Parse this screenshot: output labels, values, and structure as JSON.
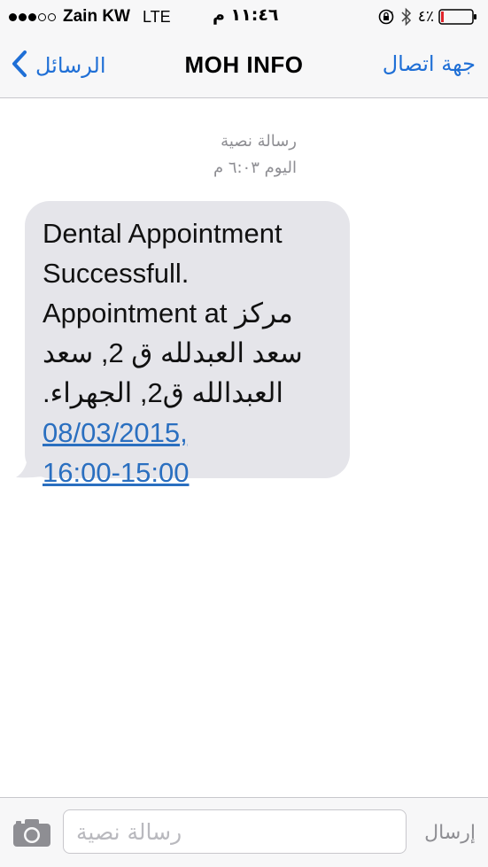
{
  "status_bar": {
    "signal_strength": 3,
    "signal_max": 5,
    "carrier": "Zain KW",
    "network": "LTE",
    "time": "١١:٤٦ م",
    "battery_percent": "٤٪",
    "icons": [
      "rotation-lock-icon",
      "bluetooth-icon",
      "battery-icon"
    ]
  },
  "nav": {
    "back_label": "الرسائل",
    "title": "MOH INFO",
    "contact_label": "جهة اتصال"
  },
  "message": {
    "type_label": "رسالة نصية",
    "timestamp": "اليوم ٦:٠٣ م",
    "lines": [
      "Dental Appointment",
      "Successfull.",
      "Appointment at مركز",
      "سعد العبدلله ق 2, سعد",
      "العبدالله ق2, الجهراء."
    ],
    "link_lines": [
      "08/03/2015,",
      "16:00-15:00"
    ]
  },
  "input_bar": {
    "placeholder": "رسالة نصية",
    "send_label": "إرسال"
  },
  "colors": {
    "accent": "#1f6fd6",
    "link": "#2a6fc0",
    "bubble": "#e5e5ea",
    "meta_text": "#8e8e93",
    "bar_bg": "#f7f7f8"
  }
}
